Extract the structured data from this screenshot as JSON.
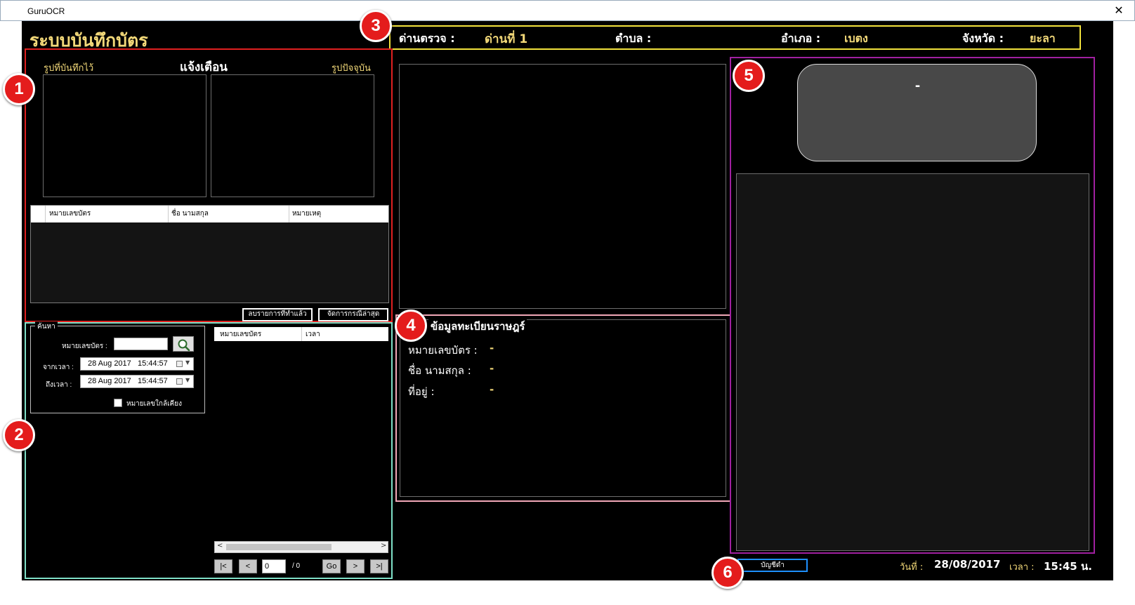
{
  "window": {
    "title": "GuruOCR",
    "close_label": "✕"
  },
  "app": {
    "heading": "ระบบบันทึกบัตร"
  },
  "markers": [
    "1",
    "2",
    "3",
    "4",
    "5",
    "6"
  ],
  "alert": {
    "saved_photo_label": "รูปที่บันทึกไว้",
    "title": "แจ้งเตือน",
    "current_photo_label": "รูปปัจจุบัน",
    "columns": [
      "หมายเลขบัตร",
      "ชื่อ นามสกุล",
      "หมายเหตุ"
    ],
    "clear_button": "ลบรายการที่ทำแล้ว",
    "manage_button": "จัดการกรณีล่าสุด"
  },
  "search": {
    "group_label": "ค้นหา",
    "card_label": "หมายเลขบัตร :",
    "card_value": "",
    "from_label": "จากเวลา :",
    "from_value": "28 Aug 2017   15:44:57",
    "to_label": "ถึงเวลา :",
    "to_value": "28 Aug 2017   15:44:57",
    "nearby_label": "หมายเลขใกล้เคียง",
    "nearby_checked": false,
    "result_columns": [
      "หมายเลขบัตร",
      "เวลา"
    ],
    "pager": {
      "first": "|<",
      "prev": "<",
      "page": "0",
      "total": "/ 0",
      "go": "Go",
      "next": ">",
      "last": ">|"
    }
  },
  "checkpoint": {
    "label": "ด่านตรวจ :",
    "value": "ด่านที่ 1",
    "tambon_label": "ตำบล :",
    "tambon_value": "",
    "amphoe_label": "อำเภอ :",
    "amphoe_value": "เบตง",
    "province_label": "จังหวัด :",
    "province_value": "ยะลา"
  },
  "registry": {
    "title": "ข้อมูลทะเบียนราษฎร์",
    "card_label": "หมายเลขบัตร :",
    "card_value": "-",
    "name_label": "ชื่อ นามสกุล :",
    "name_value": "-",
    "address_label": "ที่อยู่ :",
    "address_value": "-"
  },
  "card_display": {
    "value": "-"
  },
  "footer": {
    "blacklist_button": "บัญชีดำ",
    "date_label": "วันที่ :",
    "date_value": "28/08/2017",
    "time_label": "เวลา :",
    "time_value": "15:45 น."
  },
  "colors": {
    "section1_border": "#e02020",
    "section2_border": "#7fe0c8",
    "section3_border": "#f2e23c",
    "section4_border": "#f2a8b8",
    "section5_border": "#a020a0",
    "label_yellow": "#f3d979"
  }
}
